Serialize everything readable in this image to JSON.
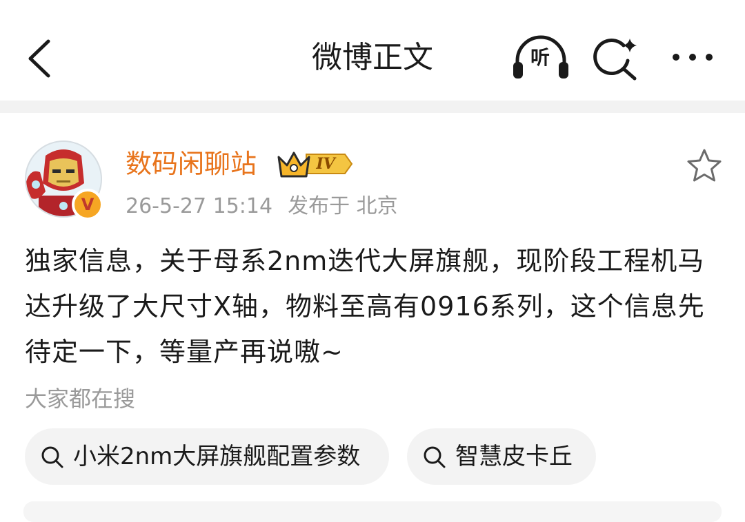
{
  "nav": {
    "back_icon": "chevron-left-icon",
    "title": "微博正文",
    "listen_label": "听",
    "listen_icon": "headphones-icon",
    "search_icon": "search-sparkle-icon",
    "more_icon": "more-dots-icon"
  },
  "post": {
    "author": {
      "name": "数码闲聊站",
      "vip_level": "IV",
      "avatar_icon": "iron-man-avatar-icon",
      "verified_badge": "V",
      "verified_color": "#f6a623",
      "name_color": "#e8741c"
    },
    "timestamp": "26-5-27 15:14",
    "location_prefix": "发布于",
    "location": "北京",
    "favorite_icon": "star-outline-icon",
    "content": "独家信息，关于母系2nm迭代大屏旗舰，现阶段工程机马达升级了大尺寸X轴，物料至高有0916系列，这个信息先待定一下，等量产再说嗷~"
  },
  "hot_search": {
    "title": "大家都在搜",
    "chips": [
      {
        "label": "小米2nm大屏旗舰配置参数",
        "icon": "search-icon"
      },
      {
        "label": "智慧皮卡丘",
        "icon": "search-icon"
      }
    ]
  }
}
